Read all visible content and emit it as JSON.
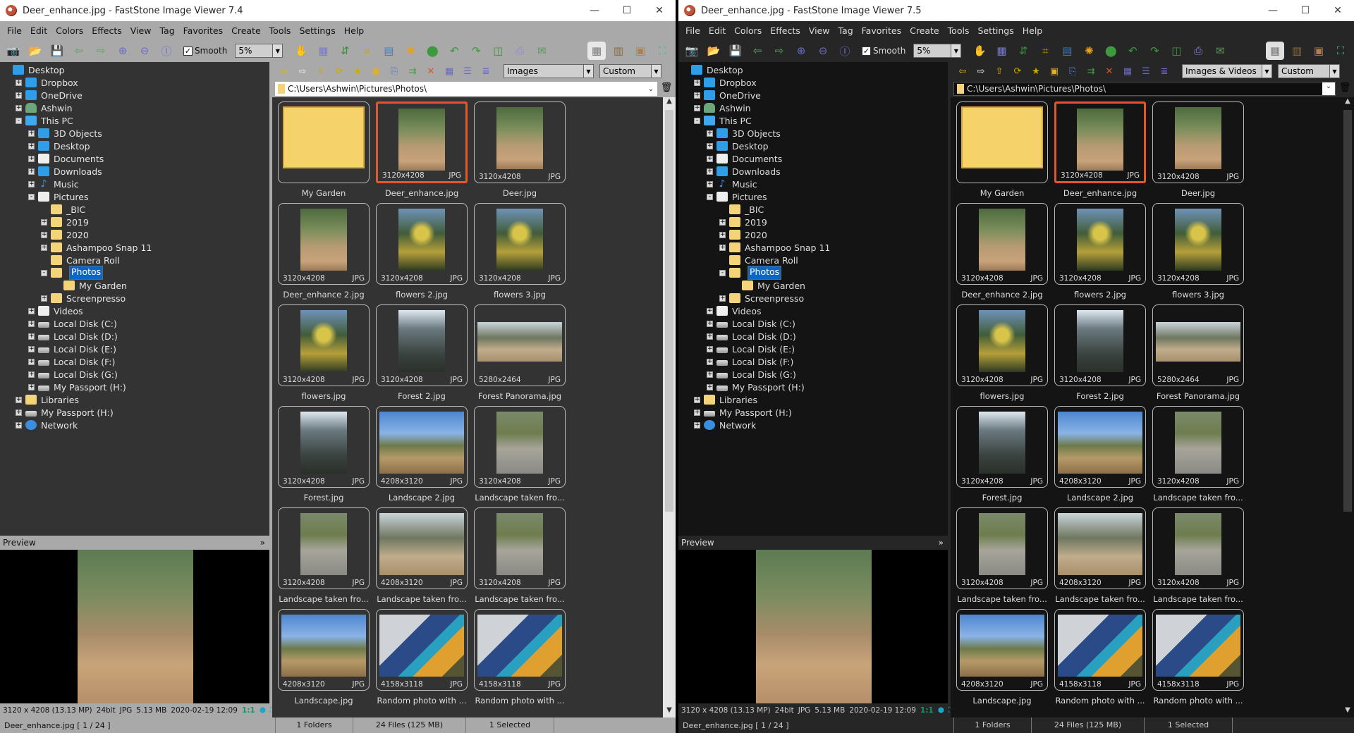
{
  "colors": {
    "accent_selection": "#e2582c",
    "tree_selection": "#0b66c6"
  },
  "windows": [
    {
      "title": "Deer_enhance.jpg  -  FastStone Image Viewer 7.4",
      "menu": [
        "File",
        "Edit",
        "Colors",
        "Effects",
        "View",
        "Tag",
        "Favorites",
        "Create",
        "Tools",
        "Settings",
        "Help"
      ],
      "toolbar": {
        "smooth_label": "Smooth",
        "smooth_checked": true,
        "zoom_value": "5%",
        "icons": [
          "acquire-icon",
          "open-icon",
          "save-icon",
          "previous-icon",
          "next-icon",
          "zoom-in-icon",
          "zoom-out-icon",
          "actual-size-icon"
        ],
        "icons2": [
          "hand-tool-icon",
          "slideshow-icon",
          "batch-convert-icon",
          "crop-icon",
          "contact-sheet-icon",
          "adjust-icon",
          "wallpaper-icon",
          "rotate-left-icon",
          "rotate-right-icon",
          "compare-icon",
          "print-icon",
          "email-icon"
        ],
        "layout_icons": [
          "browser-layout-icon",
          "thumbnail-layout-icon",
          "preview-layout-icon",
          "fullscreen-icon"
        ]
      },
      "nav": {
        "icons": [
          "back-icon",
          "forward-icon",
          "folder-up-icon",
          "refresh-icon",
          "favorites-icon",
          "new-folder-icon",
          "copy-to-icon",
          "move-to-icon",
          "delete-icon",
          "thumbnails-view-icon",
          "list-view-icon",
          "details-view-icon"
        ],
        "filter_value": "Images",
        "sort_value": "Custom Sort",
        "path": "C:\\Users\\Ashwin\\Pictures\\Photos\\"
      },
      "preview_label": "Preview",
      "preview_info": {
        "dimensions": "3120 x 4208 (13.13 MP)",
        "bits": "24bit",
        "format": "JPG",
        "size": "5.13 MB",
        "date": "2020-02-19 12:09",
        "ratio": "1:1"
      },
      "status": {
        "file": "Deer_enhance.jpg [ 1 / 24 ]",
        "folders": "1 Folders",
        "files": "24 Files (125 MB)",
        "selected": "1 Selected"
      }
    },
    {
      "title": "Deer_enhance.jpg  -  FastStone Image Viewer 7.5",
      "menu": [
        "File",
        "Edit",
        "Colors",
        "Effects",
        "View",
        "Tag",
        "Favorites",
        "Create",
        "Tools",
        "Settings",
        "Help"
      ],
      "toolbar": {
        "smooth_label": "Smooth",
        "smooth_checked": true,
        "zoom_value": "5%",
        "icons": [
          "acquire-icon",
          "open-icon",
          "save-icon",
          "previous-icon",
          "next-icon",
          "zoom-in-icon",
          "zoom-out-icon",
          "actual-size-icon"
        ],
        "icons2": [
          "hand-tool-icon",
          "slideshow-icon",
          "batch-convert-icon",
          "crop-icon",
          "contact-sheet-icon",
          "adjust-icon",
          "wallpaper-icon",
          "rotate-left-icon",
          "rotate-right-icon",
          "compare-icon",
          "print-icon",
          "email-icon"
        ],
        "layout_icons": [
          "browser-layout-icon",
          "thumbnail-layout-icon",
          "preview-layout-icon",
          "fullscreen-icon"
        ]
      },
      "nav": {
        "icons": [
          "back-icon",
          "forward-icon",
          "folder-up-icon",
          "refresh-icon",
          "favorites-icon",
          "new-folder-icon",
          "copy-to-icon",
          "move-to-icon",
          "delete-icon",
          "thumbnails-view-icon",
          "list-view-icon",
          "details-view-icon"
        ],
        "filter_value": "Images & Videos",
        "sort_value": "Custom Sort",
        "path": "C:\\Users\\Ashwin\\Pictures\\Photos\\"
      },
      "preview_label": "Preview",
      "preview_info": {
        "dimensions": "3120 x 4208 (13.13 MP)",
        "bits": "24bit",
        "format": "JPG",
        "size": "5.13 MB",
        "date": "2020-02-19 12:09",
        "ratio": "1:1"
      },
      "status": {
        "file": "Deer_enhance.jpg [ 1 / 24 ]",
        "folders": "1 Folders",
        "files": "24 Files (125 MB)",
        "selected": "1 Selected"
      }
    }
  ],
  "tree": [
    {
      "label": "Desktop",
      "level": 0,
      "exp": "none",
      "icon": "blue"
    },
    {
      "label": "Dropbox",
      "level": 1,
      "exp": "+",
      "icon": "blue"
    },
    {
      "label": "OneDrive",
      "level": 1,
      "exp": "+",
      "icon": "blue"
    },
    {
      "label": "Ashwin",
      "level": 1,
      "exp": "+",
      "icon": "person"
    },
    {
      "label": "This PC",
      "level": 1,
      "exp": "-",
      "icon": "pc"
    },
    {
      "label": "3D Objects",
      "level": 2,
      "exp": "+",
      "icon": "blue"
    },
    {
      "label": "Desktop",
      "level": 2,
      "exp": "+",
      "icon": "blue"
    },
    {
      "label": "Documents",
      "level": 2,
      "exp": "+",
      "icon": "doc"
    },
    {
      "label": "Downloads",
      "level": 2,
      "exp": "+",
      "icon": "blue"
    },
    {
      "label": "Music",
      "level": 2,
      "exp": "+",
      "icon": "music"
    },
    {
      "label": "Pictures",
      "level": 2,
      "exp": "-",
      "icon": "doc"
    },
    {
      "label": "_BIC",
      "level": 3,
      "exp": "none",
      "icon": "folder"
    },
    {
      "label": "2019",
      "level": 3,
      "exp": "+",
      "icon": "folder"
    },
    {
      "label": "2020",
      "level": 3,
      "exp": "+",
      "icon": "folder"
    },
    {
      "label": "Ashampoo Snap 11",
      "level": 3,
      "exp": "+",
      "icon": "folder"
    },
    {
      "label": "Camera Roll",
      "level": 3,
      "exp": "none",
      "icon": "folder"
    },
    {
      "label": "Photos",
      "level": 3,
      "exp": "-",
      "icon": "folder",
      "selected": true
    },
    {
      "label": "My Garden",
      "level": 4,
      "exp": "none",
      "icon": "folder"
    },
    {
      "label": "Screenpresso",
      "level": 3,
      "exp": "+",
      "icon": "folder"
    },
    {
      "label": "Videos",
      "level": 2,
      "exp": "+",
      "icon": "doc"
    },
    {
      "label": "Local Disk (C:)",
      "level": 2,
      "exp": "+",
      "icon": "drive"
    },
    {
      "label": "Local Disk (D:)",
      "level": 2,
      "exp": "+",
      "icon": "drive"
    },
    {
      "label": "Local Disk (E:)",
      "level": 2,
      "exp": "+",
      "icon": "drive"
    },
    {
      "label": "Local Disk (F:)",
      "level": 2,
      "exp": "+",
      "icon": "drive"
    },
    {
      "label": "Local Disk (G:)",
      "level": 2,
      "exp": "+",
      "icon": "drive"
    },
    {
      "label": "My Passport (H:)",
      "level": 2,
      "exp": "+",
      "icon": "drive"
    },
    {
      "label": "Libraries",
      "level": 1,
      "exp": "+",
      "icon": "folder"
    },
    {
      "label": "My Passport (H:)",
      "level": 1,
      "exp": "+",
      "icon": "drive"
    },
    {
      "label": "Network",
      "level": 1,
      "exp": "+",
      "icon": "net"
    }
  ],
  "thumbnails": [
    {
      "name": "My Garden",
      "dims": "",
      "type": "",
      "kind": "folder"
    },
    {
      "name": "Deer_enhance.jpg",
      "dims": "3120x4208",
      "type": "JPG",
      "kind": "portrait",
      "selected": true,
      "tone": "deer"
    },
    {
      "name": "Deer.jpg",
      "dims": "3120x4208",
      "type": "JPG",
      "kind": "portrait",
      "tone": "deer"
    },
    {
      "name": "Deer_enhance 2.jpg",
      "dims": "3120x4208",
      "type": "JPG",
      "kind": "portrait",
      "tone": "deer"
    },
    {
      "name": "flowers 2.jpg",
      "dims": "3120x4208",
      "type": "JPG",
      "kind": "portrait",
      "tone": "flowers"
    },
    {
      "name": "flowers 3.jpg",
      "dims": "3120x4208",
      "type": "JPG",
      "kind": "portrait",
      "tone": "flowers"
    },
    {
      "name": "flowers.jpg",
      "dims": "3120x4208",
      "type": "JPG",
      "kind": "portrait",
      "tone": "flowers"
    },
    {
      "name": "Forest 2.jpg",
      "dims": "3120x4208",
      "type": "JPG",
      "kind": "portrait",
      "tone": "forest"
    },
    {
      "name": "Forest Panorama.jpg",
      "dims": "5280x2464",
      "type": "JPG",
      "kind": "pano",
      "tone": "pano"
    },
    {
      "name": "Forest.jpg",
      "dims": "3120x4208",
      "type": "JPG",
      "kind": "portrait",
      "tone": "forest"
    },
    {
      "name": "Landscape 2.jpg",
      "dims": "4208x3120",
      "type": "JPG",
      "kind": "landscape",
      "tone": "sky"
    },
    {
      "name": "Landscape taken fro...",
      "dims": "3120x4208",
      "type": "JPG",
      "kind": "portrait",
      "tone": "wall"
    },
    {
      "name": "Landscape taken fro...",
      "dims": "3120x4208",
      "type": "JPG",
      "kind": "portrait",
      "tone": "wall"
    },
    {
      "name": "Landscape taken fro...",
      "dims": "4208x3120",
      "type": "JPG",
      "kind": "landscape",
      "tone": "pano"
    },
    {
      "name": "Landscape taken fro...",
      "dims": "3120x4208",
      "type": "JPG",
      "kind": "portrait",
      "tone": "wall"
    },
    {
      "name": "Landscape.jpg",
      "dims": "4208x3120",
      "type": "JPG",
      "kind": "landscape",
      "tone": "sky"
    },
    {
      "name": "Random photo with ...",
      "dims": "4158x3118",
      "type": "JPG",
      "kind": "landscape",
      "tone": "desk"
    },
    {
      "name": "Random photo with ...",
      "dims": "4158x3118",
      "type": "JPG",
      "kind": "landscape",
      "tone": "desk"
    }
  ],
  "window_controls": {
    "minimize": "—",
    "maximize": "☐",
    "close": "✕"
  }
}
